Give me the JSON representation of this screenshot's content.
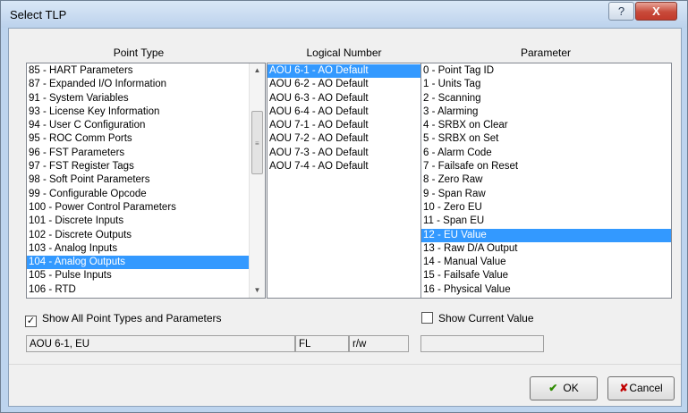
{
  "window": {
    "title": "Select TLP",
    "help_label": "?",
    "close_label": "X"
  },
  "columns": {
    "point_type": "Point Type",
    "logical_number": "Logical Number",
    "parameter": "Parameter"
  },
  "point_types": [
    "85 - HART Parameters",
    "87 - Expanded I/O Information",
    "91 - System Variables",
    "93 - License Key Information",
    "94 - User C Configuration",
    "95 - ROC Comm Ports",
    "96 - FST Parameters",
    "97 - FST Register Tags",
    "98 - Soft Point Parameters",
    "99 - Configurable Opcode",
    "100 - Power Control Parameters",
    "101 - Discrete Inputs",
    "102 - Discrete Outputs",
    "103 - Analog Inputs",
    "104 - Analog Outputs",
    "105 - Pulse Inputs",
    "106 - RTD"
  ],
  "point_type_selected_index": 14,
  "logical_numbers": [
    "AOU 6-1 - AO Default",
    "AOU 6-2 - AO Default",
    "AOU 6-3 - AO Default",
    "AOU 6-4 - AO Default",
    "AOU 7-1 - AO Default",
    "AOU 7-2 - AO Default",
    "AOU 7-3 - AO Default",
    "AOU 7-4 - AO Default"
  ],
  "logical_number_selected_index": 0,
  "parameters": [
    "0 - Point Tag ID",
    "1 - Units Tag",
    "2 - Scanning",
    "3 - Alarming",
    "4 - SRBX on Clear",
    "5 - SRBX on Set",
    "6 - Alarm Code",
    "7 - Failsafe on Reset",
    "8 - Zero Raw",
    "9 - Span Raw",
    "10 - Zero EU",
    "11 - Span EU",
    "12 - EU Value",
    "13 - Raw D/A Output",
    "14 - Manual Value",
    "15 - Failsafe Value",
    "16 - Physical Value"
  ],
  "parameter_selected_index": 12,
  "options": {
    "show_all_label": "Show All Point Types and Parameters",
    "show_all_checked": true,
    "show_current_label": "Show Current Value",
    "show_current_checked": false
  },
  "status": {
    "tlp_text": "AOU 6-1, EU",
    "type_text": "FL",
    "access_text": "r/w",
    "current_value": ""
  },
  "buttons": {
    "ok_label": "OK",
    "cancel_label": "Cancel"
  },
  "icons": {
    "ok": "checkmark-icon",
    "cancel": "x-icon"
  },
  "colors": {
    "selection": "#3399ff",
    "ok_check": "#2e8b00",
    "cancel_x": "#c00000"
  }
}
